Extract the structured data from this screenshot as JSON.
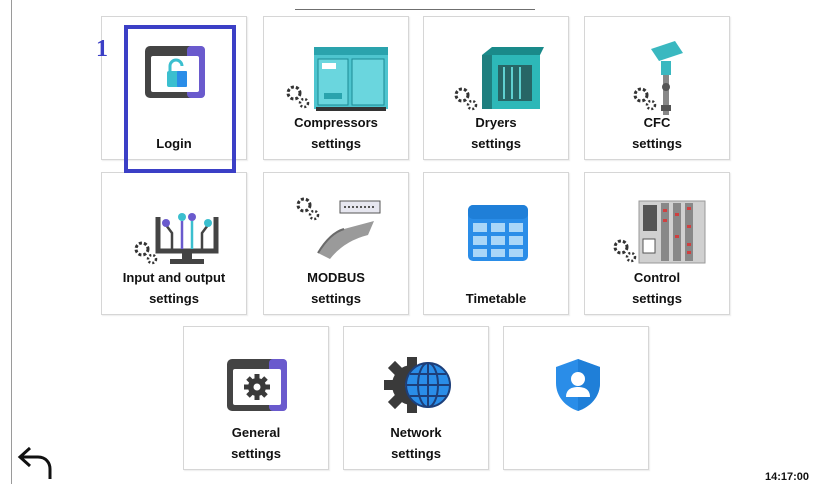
{
  "step_marker": "1",
  "tiles": [
    {
      "label": "Login",
      "icon": "lock-window-icon"
    },
    {
      "label": "Compressors\nsettings",
      "icon": "compressor-icon"
    },
    {
      "label": "Dryers\nsettings",
      "icon": "dryer-icon"
    },
    {
      "label": "CFC\nsettings",
      "icon": "flow-controller-icon"
    },
    {
      "label": "Input and output\nsettings",
      "icon": "io-monitor-icon"
    },
    {
      "label": "MODBUS\nsettings",
      "icon": "modbus-cable-icon"
    },
    {
      "label": "Timetable",
      "icon": "calendar-icon"
    },
    {
      "label": "Control\nsettings",
      "icon": "control-cabinet-icon"
    },
    {
      "label": "General\nsettings",
      "icon": "gear-window-icon"
    },
    {
      "label": "Network\nsettings",
      "icon": "gear-globe-icon"
    },
    {
      "label": "",
      "icon": "user-shield-icon"
    }
  ],
  "clock": "14:17:00",
  "colors": {
    "highlight": "#3b3fc6",
    "accent_teal": "#3bbfcf",
    "accent_blue": "#2a8de8",
    "dark_gray": "#444444",
    "purple": "#6a5acd"
  }
}
